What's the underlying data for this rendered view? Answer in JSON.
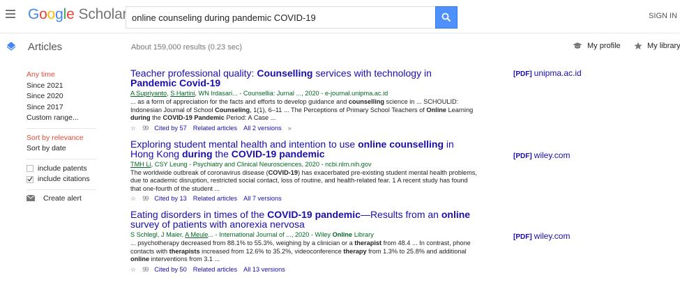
{
  "header": {
    "logo_google": [
      "G",
      "o",
      "o",
      "g",
      "l",
      "e"
    ],
    "logo_scholar": "Scholar",
    "search_value": "online counseling during pandemic COVID-19",
    "sign_in": "SIGN IN"
  },
  "subheader": {
    "articles": "Articles",
    "stats_prefix": "About 159,000 results (",
    "stats_time": "0.23",
    "stats_suffix": " sec)",
    "my_profile": "My profile",
    "my_library": "My library"
  },
  "sidebar": {
    "time_filters": [
      "Any time",
      "Since 2021",
      "Since 2020",
      "Since 2017",
      "Custom range..."
    ],
    "sort_relevance": "Sort by relevance",
    "sort_date": "Sort by date",
    "include_patents": "include patents",
    "include_citations": "include citations",
    "create_alert": "Create alert"
  },
  "results": [
    {
      "title_parts": [
        [
          "Teacher professional quality: ",
          false
        ],
        [
          "Counselling",
          true
        ],
        [
          " services with technology in ",
          false
        ],
        [
          "Pandemic Covid-19",
          true
        ]
      ],
      "meta_parts": [
        [
          "A Supriyanto",
          true
        ],
        [
          ", ",
          false
        ],
        [
          "S Hartini",
          true
        ],
        [
          ", WN Irdasari... - Counsellia: Jurnal ..., 2020 - e-journal.unipma.ac.id",
          false
        ]
      ],
      "snippet_parts": [
        [
          "... as a form of appreciation for the facts and efforts to develop guidance and ",
          false
        ],
        [
          "counselling",
          true
        ],
        [
          " science in ... SCHOULID: Indonesian Journal of School ",
          false
        ],
        [
          "Counseling",
          true
        ],
        [
          ", 1(1), 6–11 ... The Perceptions of Primary School Teachers of ",
          false
        ],
        [
          "Online",
          true
        ],
        [
          " Learning ",
          false
        ],
        [
          "during",
          true
        ],
        [
          " the ",
          false
        ],
        [
          "COVID-19 Pandemic",
          true
        ],
        [
          " Period: A Case ...",
          false
        ]
      ],
      "cited": "Cited by 57",
      "related": "Related articles",
      "versions": "All 2 versions",
      "pdf_tag": "[PDF]",
      "pdf_source": "unipma.ac.id"
    },
    {
      "title_parts": [
        [
          "Exploring student mental health and intention to use ",
          false
        ],
        [
          "online counselling",
          true
        ],
        [
          " in Hong Kong ",
          false
        ],
        [
          "during",
          true
        ],
        [
          " the ",
          false
        ],
        [
          "COVID-19 pandemic",
          true
        ]
      ],
      "meta_parts": [
        [
          "TMH Li",
          true
        ],
        [
          ", CSY Leung - Psychiatry and Clinical Neurosciences, 2020 - ncbi.nlm.nih.gov",
          false
        ]
      ],
      "snippet_parts": [
        [
          "The worldwide outbreak of coronavirus disease (",
          false
        ],
        [
          "COVID-19",
          true
        ],
        [
          ") has exacerbated pre-existing student mental health problems, due to academic disruption, restricted social contact, loss of routine, and health-related fear. 1 A recent study has found that one-fourth of the student ...",
          false
        ]
      ],
      "cited": "Cited by 13",
      "related": "Related articles",
      "versions": "All 7 versions",
      "pdf_tag": "[PDF]",
      "pdf_source": "wiley.com"
    },
    {
      "title_parts": [
        [
          "Eating disorders in times of the ",
          false
        ],
        [
          "COVID-19 pandemic",
          true
        ],
        [
          "—Results from an ",
          false
        ],
        [
          "online",
          true
        ],
        [
          " survey of patients with anorexia nervosa",
          false
        ]
      ],
      "meta_parts": [
        [
          "S Schlegl, J Maier, ",
          false
        ],
        [
          "A Meule",
          true
        ],
        [
          "... - International Journal of ..., 2020 - Wiley ",
          false
        ],
        [
          "Online",
          "b"
        ],
        [
          " Library",
          false
        ]
      ],
      "snippet_parts": [
        [
          "... psychotherapy decreased from 88.1% to 55.3%, weighing by a clinician or a ",
          false
        ],
        [
          "therapist",
          true
        ],
        [
          " from 48.4 ... In contrast, phone contacts with ",
          false
        ],
        [
          "therapists",
          true
        ],
        [
          " increased from 12.6% to 35.2%, videoconference ",
          false
        ],
        [
          "therapy",
          true
        ],
        [
          " from 1.3% to 25.8% and additional ",
          false
        ],
        [
          "online",
          true
        ],
        [
          " interventions from 3.1 ...",
          false
        ]
      ],
      "cited": "Cited by 50",
      "related": "Related articles",
      "versions": "All 13 versions",
      "pdf_tag": "[PDF]",
      "pdf_source": "wiley.com"
    }
  ],
  "colors": {
    "accent_blue": "#4d90fe",
    "active_red": "#dd4b39",
    "link": "#1a0dab",
    "green": "#006621"
  },
  "icons": [
    "menu-icon",
    "search-icon",
    "articles-icon",
    "graduation-cap-icon",
    "star-icon",
    "quote-icon",
    "more-icon",
    "mail-icon",
    "check-icon"
  ]
}
